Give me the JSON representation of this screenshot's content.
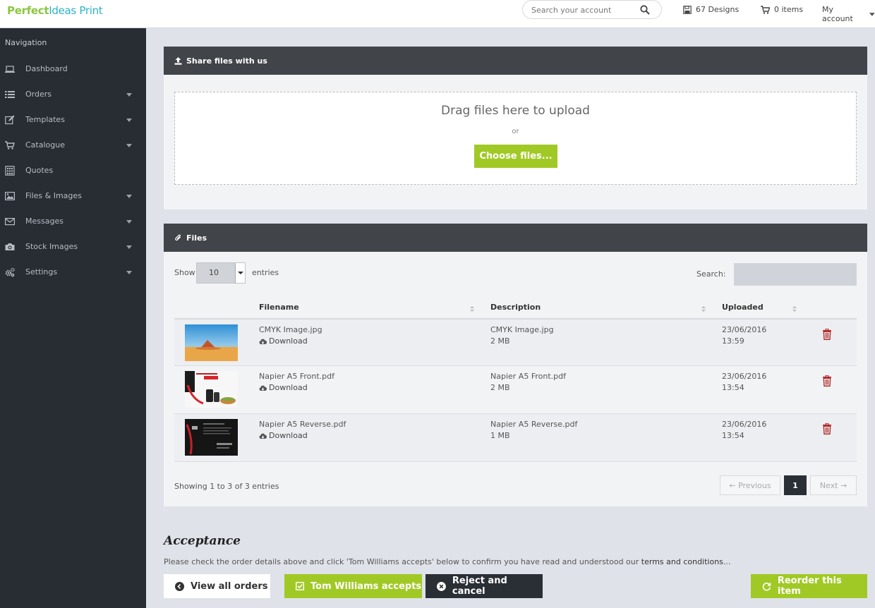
{
  "header": {
    "brand_part1": "Perfect",
    "brand_part2": "Ideas Print",
    "search_placeholder": "Search your account",
    "designs_label": "67 Designs",
    "cart_label": "0 items",
    "account_label": "My account"
  },
  "sidebar": {
    "title": "Navigation",
    "items": [
      {
        "label": "Dashboard",
        "icon": "laptop-icon",
        "has_caret": false
      },
      {
        "label": "Orders",
        "icon": "list-icon",
        "has_caret": true
      },
      {
        "label": "Templates",
        "icon": "edit-icon",
        "has_caret": true
      },
      {
        "label": "Catalogue",
        "icon": "cart-icon",
        "has_caret": true
      },
      {
        "label": "Quotes",
        "icon": "calculator-icon",
        "has_caret": false
      },
      {
        "label": "Files & Images",
        "icon": "image-icon",
        "has_caret": true
      },
      {
        "label": "Messages",
        "icon": "envelope-icon",
        "has_caret": true
      },
      {
        "label": "Stock Images",
        "icon": "camera-icon",
        "has_caret": true
      },
      {
        "label": "Settings",
        "icon": "cogs-icon",
        "has_caret": true
      }
    ]
  },
  "share_panel": {
    "title": "Share files with us",
    "drag_text": "Drag files here to upload",
    "or_text": "or",
    "choose_label": "Choose files..."
  },
  "files_panel": {
    "title": "Files",
    "show_label": "Show",
    "entries_value": "10",
    "entries_label": "entries",
    "search_label": "Search:",
    "columns": [
      "Filename",
      "Description",
      "Uploaded"
    ],
    "download_label": "Download",
    "rows": [
      {
        "filename": "CMYK Image.jpg",
        "description": "CMYK Image.jpg",
        "size": "2 MB",
        "date": "23/06/2016",
        "time": "13:59"
      },
      {
        "filename": "Napier A5 Front.pdf",
        "description": "Napier A5 Front.pdf",
        "size": "2 MB",
        "date": "23/06/2016",
        "time": "13:54"
      },
      {
        "filename": "Napier A5 Reverse.pdf",
        "description": "Napier A5 Reverse.pdf",
        "size": "1 MB",
        "date": "23/06/2016",
        "time": "13:54"
      }
    ],
    "showing_text": "Showing 1 to 3 of 3 entries",
    "prev_label": "← Previous",
    "page_label": "1",
    "next_label": "Next →"
  },
  "acceptance": {
    "title": "Acceptance",
    "text": "Please check the order details above and click 'Tom Williams accepts' below to confirm you have read and understood our ",
    "terms_link": "terms and conditions",
    "ellipsis": "...",
    "view_all_label": "View all orders",
    "accept_label": "Tom Williams accepts",
    "reject_label": "Reject and cancel",
    "reorder_label": "Reorder this item"
  },
  "colors": {
    "accent_green": "#a0c926",
    "dark": "#2a2e35",
    "sidebar_bg": "#282c33",
    "trash_red": "#b22222"
  }
}
